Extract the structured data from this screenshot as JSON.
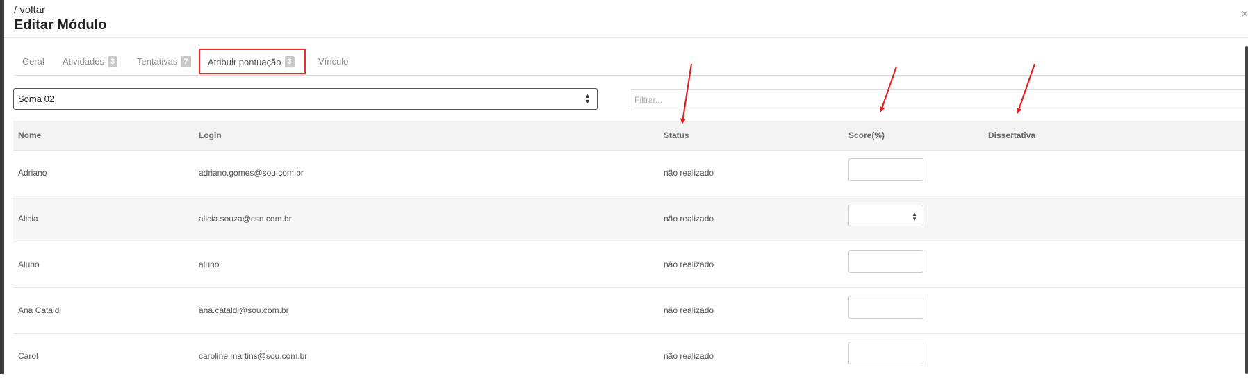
{
  "header": {
    "breadcrumb": "/ voltar",
    "title": "Editar Módulo",
    "close_label": "×"
  },
  "tabs": [
    {
      "label": "Geral",
      "badge": null
    },
    {
      "label": "Atividades",
      "badge": "3"
    },
    {
      "label": "Tentativas",
      "badge": "7"
    },
    {
      "label": "Atribuir pontuação",
      "badge": "3",
      "active": true
    },
    {
      "label": "Vínculo",
      "badge": null
    }
  ],
  "selector": {
    "value": "Soma 02"
  },
  "filter": {
    "placeholder": "Filtrar..."
  },
  "table": {
    "headers": {
      "nome": "Nome",
      "login": "Login",
      "status": "Status",
      "score": "Score(%)",
      "dissertativa": "Dissertativa"
    },
    "rows": [
      {
        "nome": "Adriano",
        "login": "adriano.gomes@sou.com.br",
        "status": "não realizado"
      },
      {
        "nome": "Alicia",
        "login": "alicia.souza@csn.com.br",
        "status": "não realizado"
      },
      {
        "nome": "Aluno",
        "login": "aluno",
        "status": "não realizado"
      },
      {
        "nome": "Ana Cataldi",
        "login": "ana.cataldi@sou.com.br",
        "status": "não realizado"
      },
      {
        "nome": "Carol",
        "login": "caroline.martins@sou.com.br",
        "status": "não realizado"
      }
    ]
  },
  "colors": {
    "highlight": "#e53030",
    "annotation_arrow": "#e32222"
  }
}
